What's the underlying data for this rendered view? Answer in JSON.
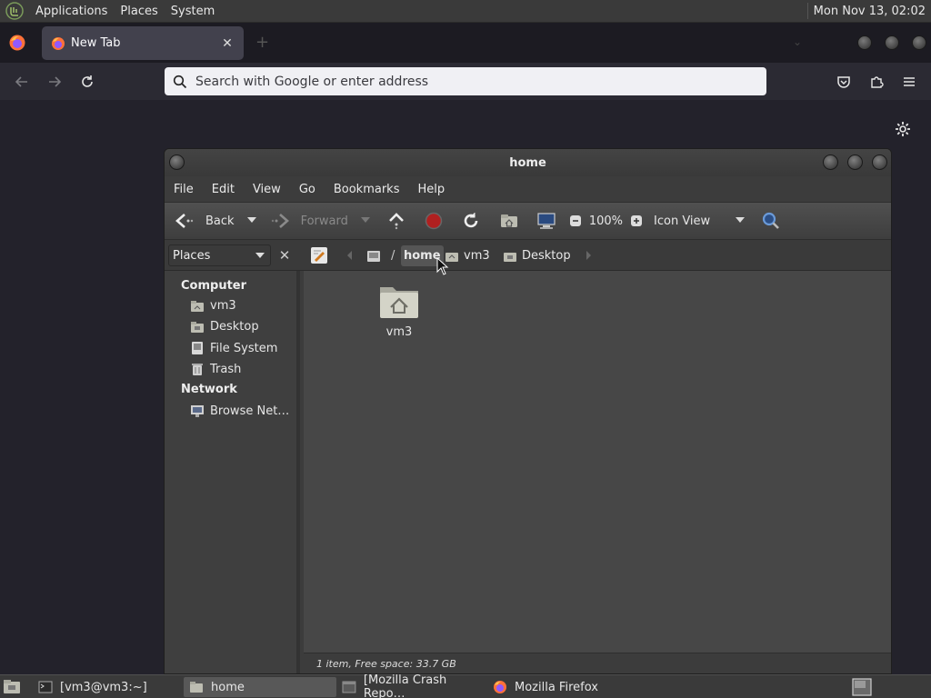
{
  "system_panel": {
    "menus": [
      "Applications",
      "Places",
      "System"
    ],
    "clock": "Mon Nov 13, 02:02"
  },
  "firefox": {
    "tab_title": "New Tab",
    "url_placeholder": "Search with Google or enter address"
  },
  "file_manager": {
    "window_title": "home",
    "menu": [
      "File",
      "Edit",
      "View",
      "Go",
      "Bookmarks",
      "Help"
    ],
    "toolbar": {
      "back_label": "Back",
      "forward_label": "Forward",
      "zoom_level": "100%",
      "view_mode": "Icon View"
    },
    "sidebar": {
      "selector_label": "Places",
      "computer_heading": "Computer",
      "computer_items": [
        "vm3",
        "Desktop",
        "File System",
        "Trash"
      ],
      "network_heading": "Network",
      "network_items": [
        "Browse Net…"
      ]
    },
    "location": {
      "separator": "/",
      "crumbs": [
        "home",
        "vm3",
        "Desktop"
      ]
    },
    "items": [
      {
        "label": "vm3",
        "icon": "home-folder-icon"
      }
    ],
    "status_text": "1 item, Free space: 33.7 GB"
  },
  "taskbar": {
    "tasks": [
      "[vm3@vm3:~]",
      "home",
      "[Mozilla Crash Repo…",
      "Mozilla Firefox"
    ]
  },
  "colors": {
    "panel_bg": "#3a3a3a",
    "firefox_bg": "#23222b",
    "fm_main_bg": "#474747",
    "stop_red": "#b02020"
  }
}
